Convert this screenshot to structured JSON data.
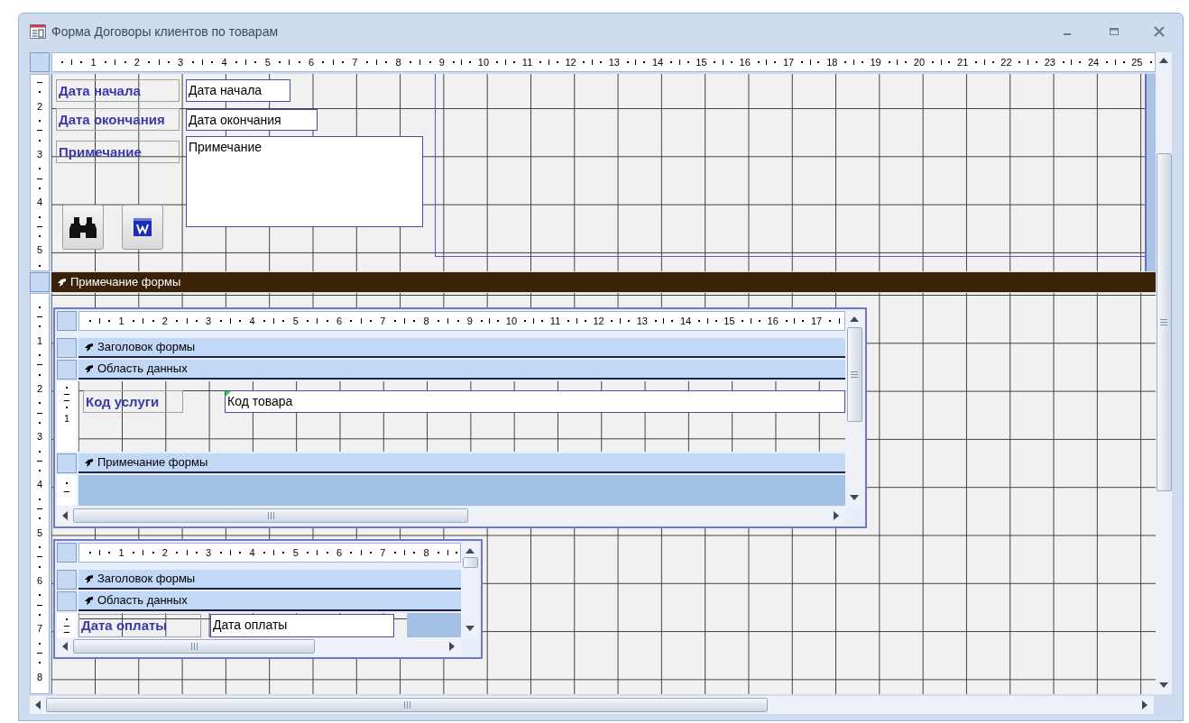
{
  "window": {
    "title": "Форма Договоры клиентов по товарам"
  },
  "ruler": {
    "labels": [
      "1",
      "2",
      "3",
      "4",
      "5",
      "6",
      "7",
      "8",
      "9",
      "10",
      "11",
      "12",
      "13",
      "14",
      "15",
      "16",
      "17",
      "18",
      "19",
      "20",
      "21",
      "22",
      "23",
      "24",
      "25"
    ]
  },
  "vertical_ruler": {
    "detail_labels": [
      "2",
      "3",
      "4",
      "5"
    ],
    "footer_labels": [
      "1",
      "2",
      "3",
      "4",
      "5",
      "6",
      "7",
      "8"
    ]
  },
  "detail": {
    "fields": [
      {
        "label": "Дата начала",
        "textbox": "Дата начала"
      },
      {
        "label": "Дата окончания",
        "textbox": "Дата окончания"
      },
      {
        "label": "Примечание",
        "textbox": "Примечание"
      }
    ]
  },
  "footer_band": {
    "title": "Примечание формы"
  },
  "subforms": [
    {
      "ruler_labels": [
        "1",
        "2",
        "3",
        "4",
        "5",
        "6",
        "7",
        "8",
        "9",
        "10",
        "11",
        "12",
        "13",
        "14",
        "15",
        "16",
        "17"
      ],
      "vertical_ruler_labels": [
        "1"
      ],
      "sections": [
        {
          "kind": "header",
          "title": "Заголовок формы"
        },
        {
          "kind": "detail",
          "title": "Область данных"
        },
        {
          "kind": "footer",
          "title": "Примечание формы"
        }
      ],
      "fields": [
        {
          "label": "Код услуги",
          "textbox": "Код товара",
          "flagged": true
        }
      ]
    },
    {
      "ruler_labels": [
        "1",
        "2",
        "3",
        "4",
        "5",
        "6",
        "7",
        "8"
      ],
      "sections": [
        {
          "kind": "header",
          "title": "Заголовок формы"
        },
        {
          "kind": "detail",
          "title": "Область данных"
        }
      ],
      "fields": [
        {
          "label": "Дата оплаты",
          "textbox": "Дата оплаты",
          "flagged": false
        }
      ]
    }
  ]
}
